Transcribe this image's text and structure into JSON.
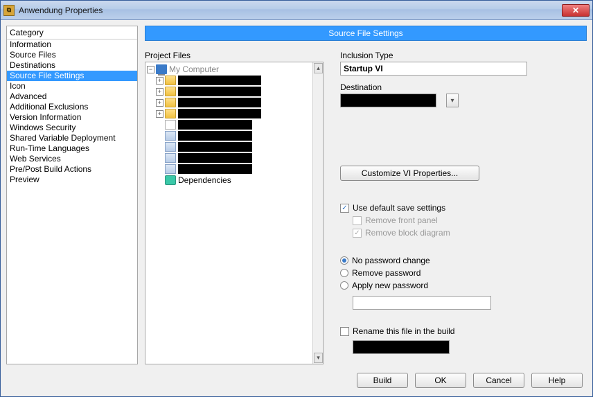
{
  "window": {
    "title": "Anwendung Properties"
  },
  "category": {
    "header": "Category",
    "items": [
      "Information",
      "Source Files",
      "Destinations",
      "Source File Settings",
      "Icon",
      "Advanced",
      "Additional Exclusions",
      "Version Information",
      "Windows Security",
      "Shared Variable Deployment",
      "Run-Time Languages",
      "Web Services",
      "Pre/Post Build Actions",
      "Preview"
    ],
    "selected_index": 3
  },
  "section": {
    "title": "Source File Settings"
  },
  "tree": {
    "label": "Project Files",
    "root": "My Computer",
    "dependencies": "Dependencies"
  },
  "settings": {
    "inclusion_label": "Inclusion Type",
    "inclusion_value": "Startup VI",
    "destination_label": "Destination",
    "customize_btn": "Customize VI Properties...",
    "use_default": "Use default save settings",
    "remove_front": "Remove front panel",
    "remove_block": "Remove block diagram",
    "pw_none": "No password change",
    "pw_remove": "Remove password",
    "pw_apply": "Apply new password",
    "rename": "Rename this file in the build"
  },
  "footer": {
    "build": "Build",
    "ok": "OK",
    "cancel": "Cancel",
    "help": "Help"
  }
}
